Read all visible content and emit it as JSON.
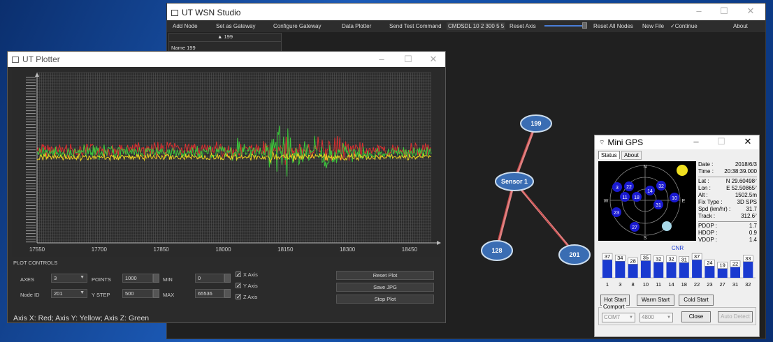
{
  "wsn": {
    "title": "UT WSN Studio",
    "menu": [
      "Add Node",
      "Set as Gateway",
      "Configure Gateway",
      "Data Plotter",
      "Send Test Command",
      "CMDSDL 10 2 300 5 5",
      "Reset Axis",
      "Reset All Nodes",
      "New File",
      "Continue",
      "About"
    ],
    "node_panel": {
      "selector": "199",
      "arrow": "▲",
      "name_label": "Name",
      "name_value": "199"
    },
    "nodes": [
      {
        "label": "199"
      },
      {
        "label": "Sensor 1"
      },
      {
        "label": "128"
      },
      {
        "label": "201"
      }
    ]
  },
  "plotter": {
    "title": "UT Plotter",
    "x_ticks": [
      "17550",
      "17700",
      "17850",
      "18000",
      "18150",
      "18300",
      "18450"
    ],
    "controls_header": "PLOT CONTROLS",
    "axes_label": "AXES",
    "axes_value": "3",
    "node_label": "Node ID",
    "node_value": "201",
    "points_label": "POINTS",
    "points_value": "1000",
    "ystep_label": "Y STEP",
    "ystep_value": "500",
    "min_label": "MIN",
    "min_value": "0",
    "max_label": "MAX",
    "max_value": "65536",
    "x_axis": "X Axis",
    "y_axis": "Y Axis",
    "z_axis": "Z Axis",
    "reset_plot": "Reset Plot",
    "save_jpg": "Save JPG",
    "stop_plot": "Stop Plot",
    "legend_text": "Axis X: Red; Axis Y: Yellow; Axis Z: Green"
  },
  "gps": {
    "title": "Mini GPS",
    "tabs": [
      "Status",
      "About"
    ],
    "compass": [
      "N",
      "E",
      "S",
      "W"
    ],
    "sats": [
      {
        "id": "3",
        "color": "#1a1ad0"
      },
      {
        "id": "22",
        "color": "#1a1ad0"
      },
      {
        "id": "14",
        "color": "#1a1ad0"
      },
      {
        "id": "32",
        "color": "#1a1ad0"
      },
      {
        "id": "11",
        "color": "#1a1ad0"
      },
      {
        "id": "18",
        "color": "#1a1ad0"
      },
      {
        "id": "10",
        "color": "#1a1ad0"
      },
      {
        "id": "31",
        "color": "#1a1ad0"
      },
      {
        "id": "23",
        "color": "#1a1ad0"
      },
      {
        "id": "27",
        "color": "#1a1ad0"
      },
      {
        "id": "",
        "color": "#a8d8e8"
      }
    ],
    "date_label": "Date :",
    "date": "2018/6/3",
    "time_label": "Time :",
    "time": "20:38:39.000",
    "lat_label": "Lat :",
    "lat": "N 29.60498⁷",
    "lon_label": "Lon :",
    "lon": "E 52.50865⁷",
    "alt_label": "Alt :",
    "alt": "1502.5m",
    "fix_label": "Fix Type :",
    "fix": "3D SPS",
    "spd_label": "Spd (km/hr) :",
    "spd": "31.7",
    "track_label": "Track :",
    "track": "312.6⁷",
    "pdop_label": "PDOP :",
    "pdop": "1.7",
    "hdop_label": "HDOP :",
    "hdop": "0.9",
    "vdop_label": "VDOP :",
    "vdop": "1.4",
    "cnr_title": "CNR",
    "cnr_bars": [
      {
        "id": "1",
        "v": 37
      },
      {
        "id": "3",
        "v": 34
      },
      {
        "id": "8",
        "v": 28
      },
      {
        "id": "10",
        "v": 35
      },
      {
        "id": "11",
        "v": 32
      },
      {
        "id": "14",
        "v": 32
      },
      {
        "id": "18",
        "v": 31
      },
      {
        "id": "22",
        "v": 37
      },
      {
        "id": "23",
        "v": 24
      },
      {
        "id": "27",
        "v": 19
      },
      {
        "id": "31",
        "v": 22
      },
      {
        "id": "32",
        "v": 33
      }
    ],
    "hot_start": "Hot Start",
    "warm_start": "Warm Start",
    "cold_start": "Cold Start",
    "comport_label": "Comport",
    "com": "COM7",
    "baud": "4800",
    "close": "Close",
    "auto_detect": "Auto Detect"
  },
  "colors": {
    "x": "#d83030",
    "y": "#e8d020",
    "z": "#3cc83c",
    "node": "#3a6db3"
  }
}
